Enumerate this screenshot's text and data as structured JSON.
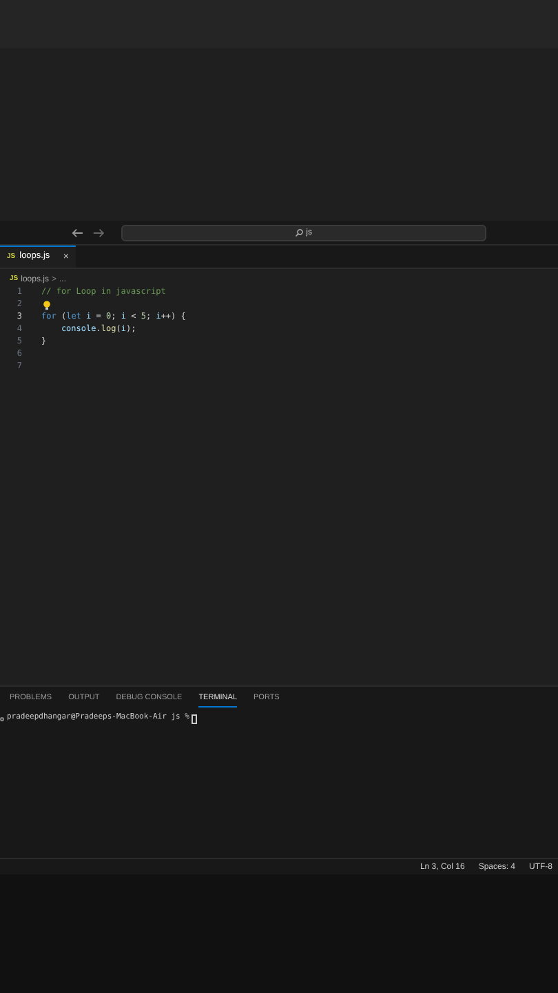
{
  "command_center": {
    "search_text": "js"
  },
  "tabs": [
    {
      "label": "loops.js",
      "icon": "JS",
      "close": "×",
      "selected": true
    }
  ],
  "breadcrumb": {
    "icon": "JS",
    "file": "loops.js",
    "separator": ">",
    "rest": "..."
  },
  "editor": {
    "lines": [
      {
        "number": "1",
        "active": false,
        "tokens": [
          {
            "kind": "comment",
            "text": "// for Loop in javascript"
          }
        ]
      },
      {
        "number": "2",
        "active": false,
        "lightbulb": true
      },
      {
        "number": "3",
        "active": true,
        "tokens": [
          {
            "kind": "keyword",
            "text": "for"
          },
          {
            "kind": "plain",
            "text": " ("
          },
          {
            "kind": "keyword",
            "text": "let"
          },
          {
            "kind": "variable",
            "text": " i "
          },
          {
            "kind": "plain",
            "text": "= "
          },
          {
            "kind": "number",
            "text": "0"
          },
          {
            "kind": "plain",
            "text": "; "
          },
          {
            "kind": "variable",
            "text": "i"
          },
          {
            "kind": "plain",
            "text": " < "
          },
          {
            "kind": "number",
            "text": "5"
          },
          {
            "kind": "plain",
            "text": "; "
          },
          {
            "kind": "variable",
            "text": "i"
          },
          {
            "kind": "plain",
            "text": "++) {"
          }
        ]
      },
      {
        "number": "4",
        "active": false,
        "tokens": [
          {
            "kind": "variable",
            "text": "    console"
          },
          {
            "kind": "plain",
            "text": "."
          },
          {
            "kind": "function",
            "text": "log"
          },
          {
            "kind": "plain",
            "text": "("
          },
          {
            "kind": "variable",
            "text": "i"
          },
          {
            "kind": "plain",
            "text": ");"
          }
        ]
      },
      {
        "number": "5",
        "active": false,
        "tokens": [
          {
            "kind": "plain",
            "text": "}"
          }
        ]
      },
      {
        "number": "6",
        "active": false
      },
      {
        "number": "7",
        "active": false
      }
    ]
  },
  "panel_tabs": [
    {
      "label": "PROBLEMS",
      "selected": false
    },
    {
      "label": "OUTPUT",
      "selected": false
    },
    {
      "label": "DEBUG CONSOLE",
      "selected": false
    },
    {
      "label": "TERMINAL",
      "selected": true
    },
    {
      "label": "PORTS",
      "selected": false
    }
  ],
  "terminal": {
    "prompt": "pradeepdhangar@Pradeeps-MacBook-Air js %"
  },
  "status_bar": [
    "Ln 3, Col 16",
    "Spaces: 4",
    "UTF-8"
  ]
}
